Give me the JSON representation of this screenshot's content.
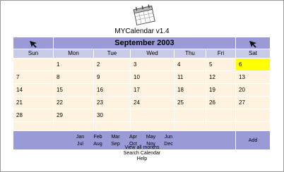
{
  "app": {
    "title": "MYCalendar v1.4"
  },
  "calendar": {
    "month_title": "September 2003",
    "weekdays": [
      "Sun",
      "Mon",
      "Tue",
      "Wed",
      "Thu",
      "Fri",
      "Sat"
    ],
    "weeks": [
      [
        "",
        "1",
        "2",
        "3",
        "4",
        "5",
        "6"
      ],
      [
        "7",
        "8",
        "9",
        "10",
        "11",
        "12",
        "13"
      ],
      [
        "14",
        "15",
        "16",
        "17",
        "18",
        "19",
        "20"
      ],
      [
        "21",
        "22",
        "23",
        "24",
        "25",
        "26",
        "27"
      ],
      [
        "28",
        "29",
        "30",
        "",
        "",
        "",
        ""
      ]
    ],
    "today": "6"
  },
  "months_nav": {
    "row1": [
      "Jan",
      "Feb",
      "Mar",
      "Apr",
      "May",
      "Jun"
    ],
    "row2": [
      "Jul",
      "Aug",
      "Sep",
      "Oct",
      "Nov",
      "Dec"
    ]
  },
  "actions": {
    "add_label": "Add"
  },
  "footer_links": [
    "View all months",
    "Search Calendar",
    "Help"
  ],
  "colors": {
    "header": "#9a9ad6",
    "weekday_bar": "#c9c9e8",
    "day_cell": "#fff3e0",
    "today": "#ffff00"
  },
  "icons": {
    "logo": "calendar-logo-icon",
    "prev": "prev-month-arrow-icon",
    "next": "next-month-arrow-icon"
  }
}
